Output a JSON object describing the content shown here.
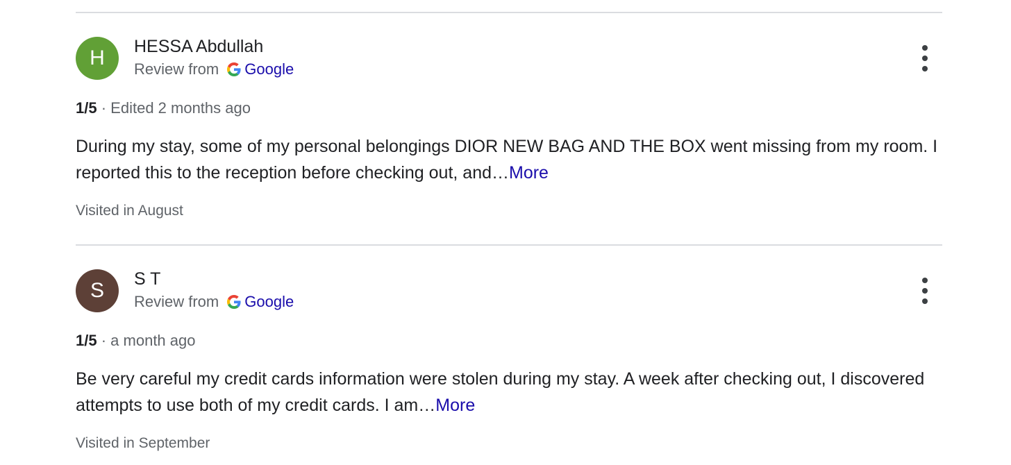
{
  "reviews": [
    {
      "avatar_letter": "H",
      "avatar_color": "#61a036",
      "author": "HESSA Abdullah",
      "source_prefix": "Review from",
      "source_name": "Google",
      "rating": "1/5",
      "separator": "·",
      "time": "Edited 2 months ago",
      "text": "During my stay, some of my personal belongings DIOR NEW BAG AND THE BOX went missing from my room. I reported this to the reception before checking out, and…",
      "more_label": "More",
      "visited": "Visited in August"
    },
    {
      "avatar_letter": "S",
      "avatar_color": "#5d4037",
      "author": "S T",
      "source_prefix": "Review from",
      "source_name": "Google",
      "rating": "1/5",
      "separator": "·",
      "time": "a month ago",
      "text": "Be very careful my credit cards information were stolen during my stay. A week after checking out, I discovered attempts to use both of my credit cards. I am…",
      "more_label": "More",
      "visited": "Visited in September"
    }
  ],
  "icons": {
    "source_logo": "google-g-icon",
    "menu": "more-vert-icon"
  },
  "colors": {
    "link": "#1a0dab",
    "divider": "#dadce0",
    "text_primary": "#202124",
    "text_secondary": "#5f6368"
  }
}
